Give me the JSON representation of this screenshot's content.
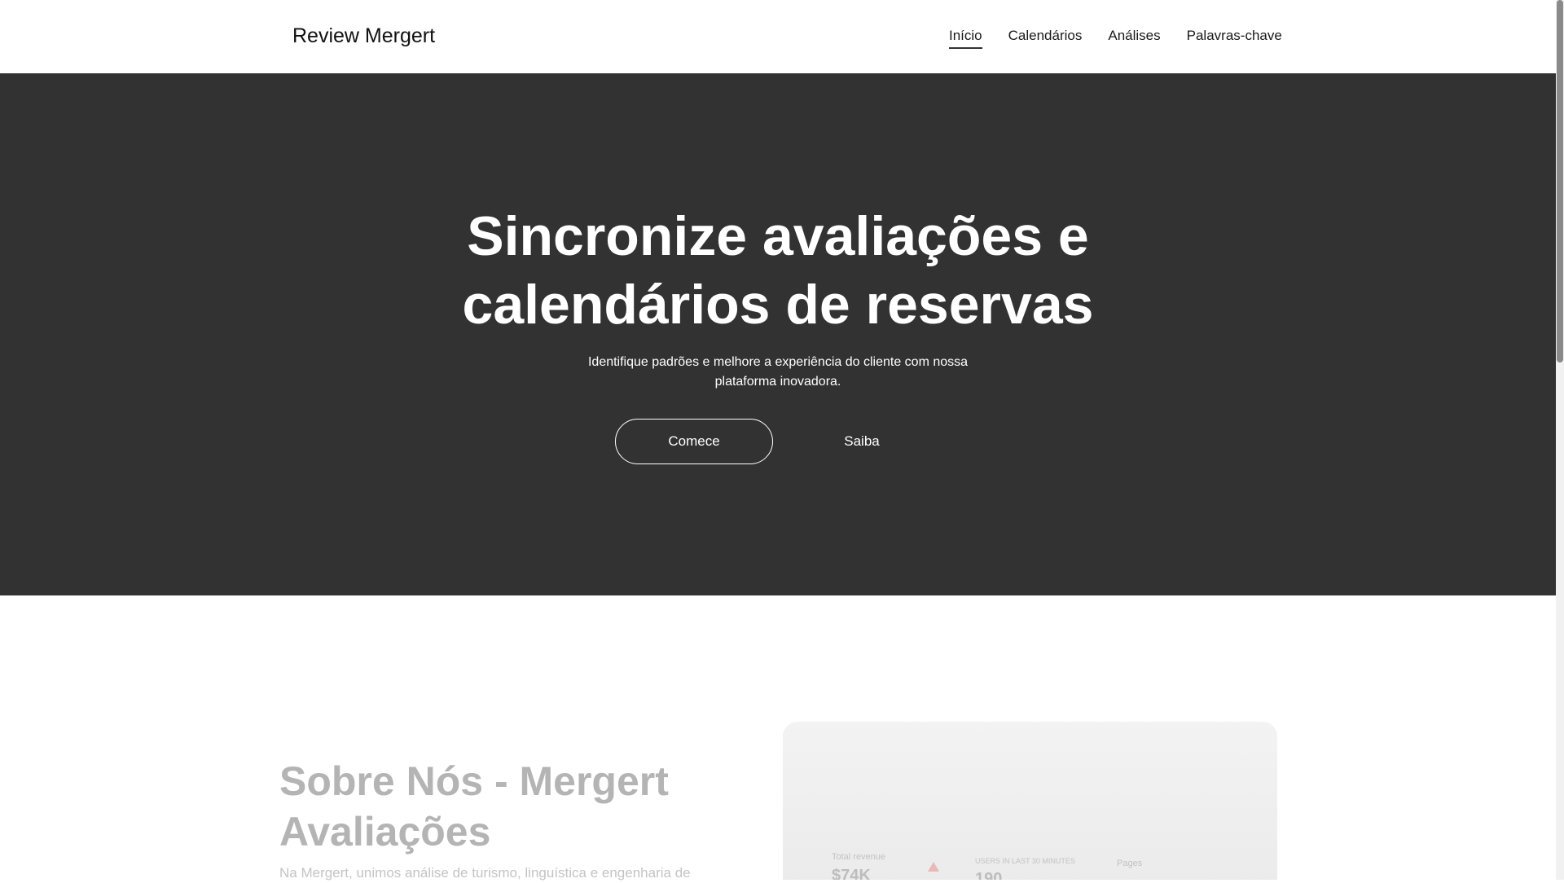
{
  "header": {
    "brand": "Review Mergert",
    "nav": [
      {
        "label": "Início",
        "active": true
      },
      {
        "label": "Calendários",
        "active": false
      },
      {
        "label": "Análises",
        "active": false
      },
      {
        "label": "Palavras-chave",
        "active": false
      }
    ]
  },
  "hero": {
    "title_line1": "Sincronize avaliações e",
    "title_line2": "calendários de reservas",
    "subtitle": "Identifique padrões e melhore a experiência do cliente com nossa plataforma inovadora.",
    "primary_button": "Comece",
    "secondary_button": "Saiba"
  },
  "about": {
    "title": "Sobre Nós - Mergert Avaliações",
    "text": "Na Mergert, unimos análise de turismo, linguística e engenharia de",
    "dashboard": {
      "total_revenue_label": "Total revenue",
      "total_revenue_value": "$74K",
      "users_label": "USERS IN LAST 30 MINUTES",
      "users_value": "190",
      "pages_label": "Pages"
    }
  },
  "colors": {
    "hero_bg": "#323232",
    "nav_active_underline": "#333333"
  }
}
